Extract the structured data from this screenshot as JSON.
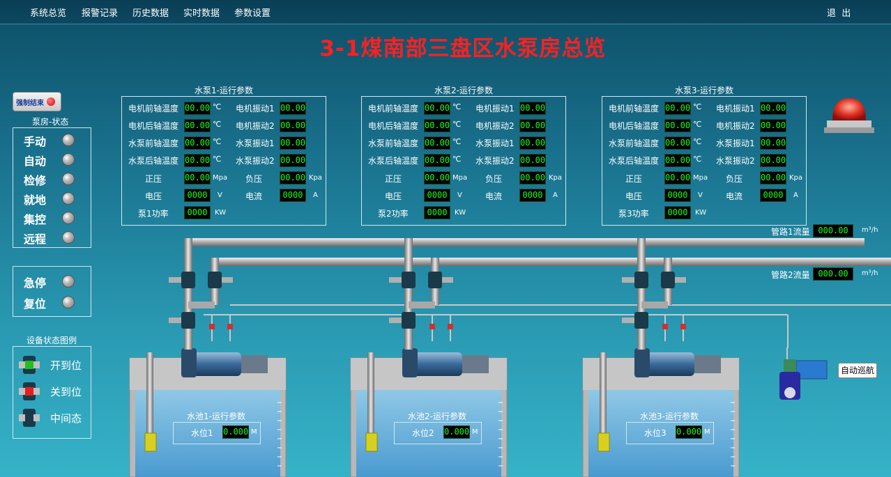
{
  "menu": [
    "系统总览",
    "报警记录",
    "历史数据",
    "实时数据",
    "参数设置"
  ],
  "logout": "退  出",
  "title": "3-1煤南部三盘区水泵房总览",
  "force_end_label": "强制结束",
  "pump_room_status": {
    "title": "泵房-状态",
    "modes": [
      "手动",
      "自动",
      "检修",
      "就地",
      "集控",
      "远程"
    ]
  },
  "emergency": {
    "stop": "急停",
    "reset": "复位"
  },
  "legend": {
    "title": "设备状态图例",
    "items": [
      "开到位",
      "关到位",
      "中间态"
    ]
  },
  "pumps": [
    {
      "title": "水泵1-运行参数",
      "temps": [
        {
          "label": "电机前轴温度",
          "value": "00.00",
          "unit": "℃"
        },
        {
          "label": "电机后轴温度",
          "value": "00.00",
          "unit": "℃"
        },
        {
          "label": "水泵前轴温度",
          "value": "00.00",
          "unit": "℃"
        },
        {
          "label": "水泵后轴温度",
          "value": "00.00",
          "unit": "℃"
        }
      ],
      "vibs": [
        {
          "label": "电机振动1",
          "value": "00.00"
        },
        {
          "label": "电机振动2",
          "value": "00.00"
        },
        {
          "label": "水泵振动1",
          "value": "00.00"
        },
        {
          "label": "水泵振动2",
          "value": "00.00"
        }
      ],
      "positive": {
        "label": "正压",
        "value": "00.00",
        "unit": "Mpa"
      },
      "negative": {
        "label": "负压",
        "value": "00.00",
        "unit": "Kpa"
      },
      "voltage": {
        "label": "电压",
        "value": "0000",
        "unit": "V"
      },
      "current": {
        "label": "电流",
        "value": "0000",
        "unit": "A"
      },
      "power": {
        "label": "泵1功率",
        "value": "0000",
        "unit": "KW"
      }
    },
    {
      "title": "水泵2-运行参数",
      "temps": [
        {
          "label": "电机前轴温度",
          "value": "00.00",
          "unit": "℃"
        },
        {
          "label": "电机后轴温度",
          "value": "00.00",
          "unit": "℃"
        },
        {
          "label": "水泵前轴温度",
          "value": "00.00",
          "unit": "℃"
        },
        {
          "label": "水泵后轴温度",
          "value": "00.00",
          "unit": "℃"
        }
      ],
      "vibs": [
        {
          "label": "电机振动1",
          "value": "00.00"
        },
        {
          "label": "电机振动2",
          "value": "00.00"
        },
        {
          "label": "水泵振动1",
          "value": "00.00"
        },
        {
          "label": "水泵振动2",
          "value": "00.00"
        }
      ],
      "positive": {
        "label": "正压",
        "value": "00.00",
        "unit": "Mpa"
      },
      "negative": {
        "label": "负压",
        "value": "00.00",
        "unit": "Kpa"
      },
      "voltage": {
        "label": "电压",
        "value": "0000",
        "unit": "V"
      },
      "current": {
        "label": "电流",
        "value": "0000",
        "unit": "A"
      },
      "power": {
        "label": "泵2功率",
        "value": "0000",
        "unit": "KW"
      }
    },
    {
      "title": "水泵3-运行参数",
      "temps": [
        {
          "label": "电机前轴温度",
          "value": "00.00",
          "unit": "℃"
        },
        {
          "label": "电机后轴温度",
          "value": "00.00",
          "unit": "℃"
        },
        {
          "label": "水泵前轴温度",
          "value": "00.00",
          "unit": "℃"
        },
        {
          "label": "水泵后轴温度",
          "value": "00.00",
          "unit": "℃"
        }
      ],
      "vibs": [
        {
          "label": "电机振动1",
          "value": "00.00"
        },
        {
          "label": "电机振动2",
          "value": "00.00"
        },
        {
          "label": "水泵振动1",
          "value": "00.00"
        },
        {
          "label": "水泵振动2",
          "value": "00.00"
        }
      ],
      "positive": {
        "label": "正压",
        "value": "00.00",
        "unit": "Mpa"
      },
      "negative": {
        "label": "负压",
        "value": "00.00",
        "unit": "Kpa"
      },
      "voltage": {
        "label": "电压",
        "value": "0000",
        "unit": "V"
      },
      "current": {
        "label": "电流",
        "value": "0000",
        "unit": "A"
      },
      "power": {
        "label": "泵3功率",
        "value": "0000",
        "unit": "KW"
      }
    }
  ],
  "flows": [
    {
      "label": "管路1流量",
      "value": "000.00",
      "unit": "m³/h"
    },
    {
      "label": "管路2流量",
      "value": "000.00",
      "unit": "m³/h"
    }
  ],
  "tanks": [
    {
      "title": "水池1-运行参数",
      "level_label": "水位1",
      "level_value": "0.000",
      "unit": "M"
    },
    {
      "title": "水池2-运行参数",
      "level_label": "水位2",
      "level_value": "0.000",
      "unit": "M"
    },
    {
      "title": "水池3-运行参数",
      "level_label": "水位3",
      "level_value": "0.000",
      "unit": "M"
    }
  ],
  "auto_patrol": "自动巡航",
  "colors": {
    "title": "#ff2020",
    "value_text": "#1aff1a",
    "value_bg": "#000000",
    "alarm": "#e03020"
  }
}
